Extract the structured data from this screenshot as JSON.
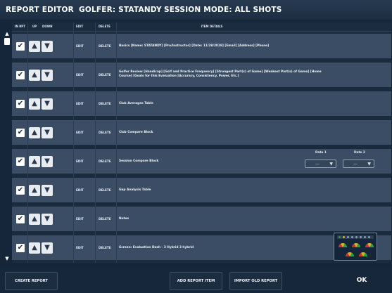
{
  "title_bar": {
    "editor": "REPORT EDITOR",
    "golfer": "GOLFER: STATANDY",
    "session": "SESSION MODE: ALL SHOTS"
  },
  "columns": {
    "in_rpt": "IN RPT",
    "up": "UP",
    "down": "DOWN",
    "edit": "EDIT",
    "delete": "DELETE",
    "item_details": "ITEM DETAILS"
  },
  "rows": [
    {
      "checked": true,
      "edit": "EDIT",
      "delete": "DELETE",
      "details": "Basics [Name: STATANDY] [Pro/Instructor] [Date: 11/28/2018] [Email] [Address] [Phone]"
    },
    {
      "checked": true,
      "edit": "EDIT",
      "delete": "DELETE",
      "details": "Golfer Review [Handicap] [Golf and Practice Frequency] [Strongest Part(s) of Game] [Weakest Part(s) of Game] [Home Course] [Goals for this Evaluation [Accuracy, Consistency, Power, Etc.]"
    },
    {
      "checked": true,
      "edit": "EDIT",
      "delete": "DELETE",
      "details": "Club Averages Table"
    },
    {
      "checked": true,
      "edit": "EDIT",
      "delete": "DELETE",
      "details": "Club Compare Block"
    },
    {
      "checked": true,
      "edit": "EDIT",
      "delete": "DELETE",
      "details": "Session Compare Block",
      "date1_label": "Date 1",
      "date2_label": "Date 2",
      "date1_value": "—",
      "date2_value": "—"
    },
    {
      "checked": true,
      "edit": "EDIT",
      "delete": "DELETE",
      "details": "Gap Analysis Table"
    },
    {
      "checked": true,
      "edit": "EDIT",
      "delete": "DELETE",
      "details": "Notes"
    },
    {
      "checked": true,
      "edit": "EDIT",
      "delete": "DELETE",
      "details": "Screen: Evaluation Dash - 3 Hybrid 3 hybrid"
    }
  ],
  "buttons": {
    "create": "CREATE REPORT",
    "add": "ADD REPORT ITEM",
    "import": "IMPORT OLD REPORT",
    "ok": "OK"
  },
  "icons": {
    "check": "✔",
    "up": "▲",
    "down": "▼",
    "scroll_up": "▲",
    "scroll_down": "▼",
    "caret": "▼"
  },
  "colors": {
    "row_bg": "#3a4d64",
    "background": "#16263a",
    "gauge_red": "#c0392b",
    "gauge_green": "#2e9e4a",
    "gauge_yellow": "#d8b02a"
  }
}
